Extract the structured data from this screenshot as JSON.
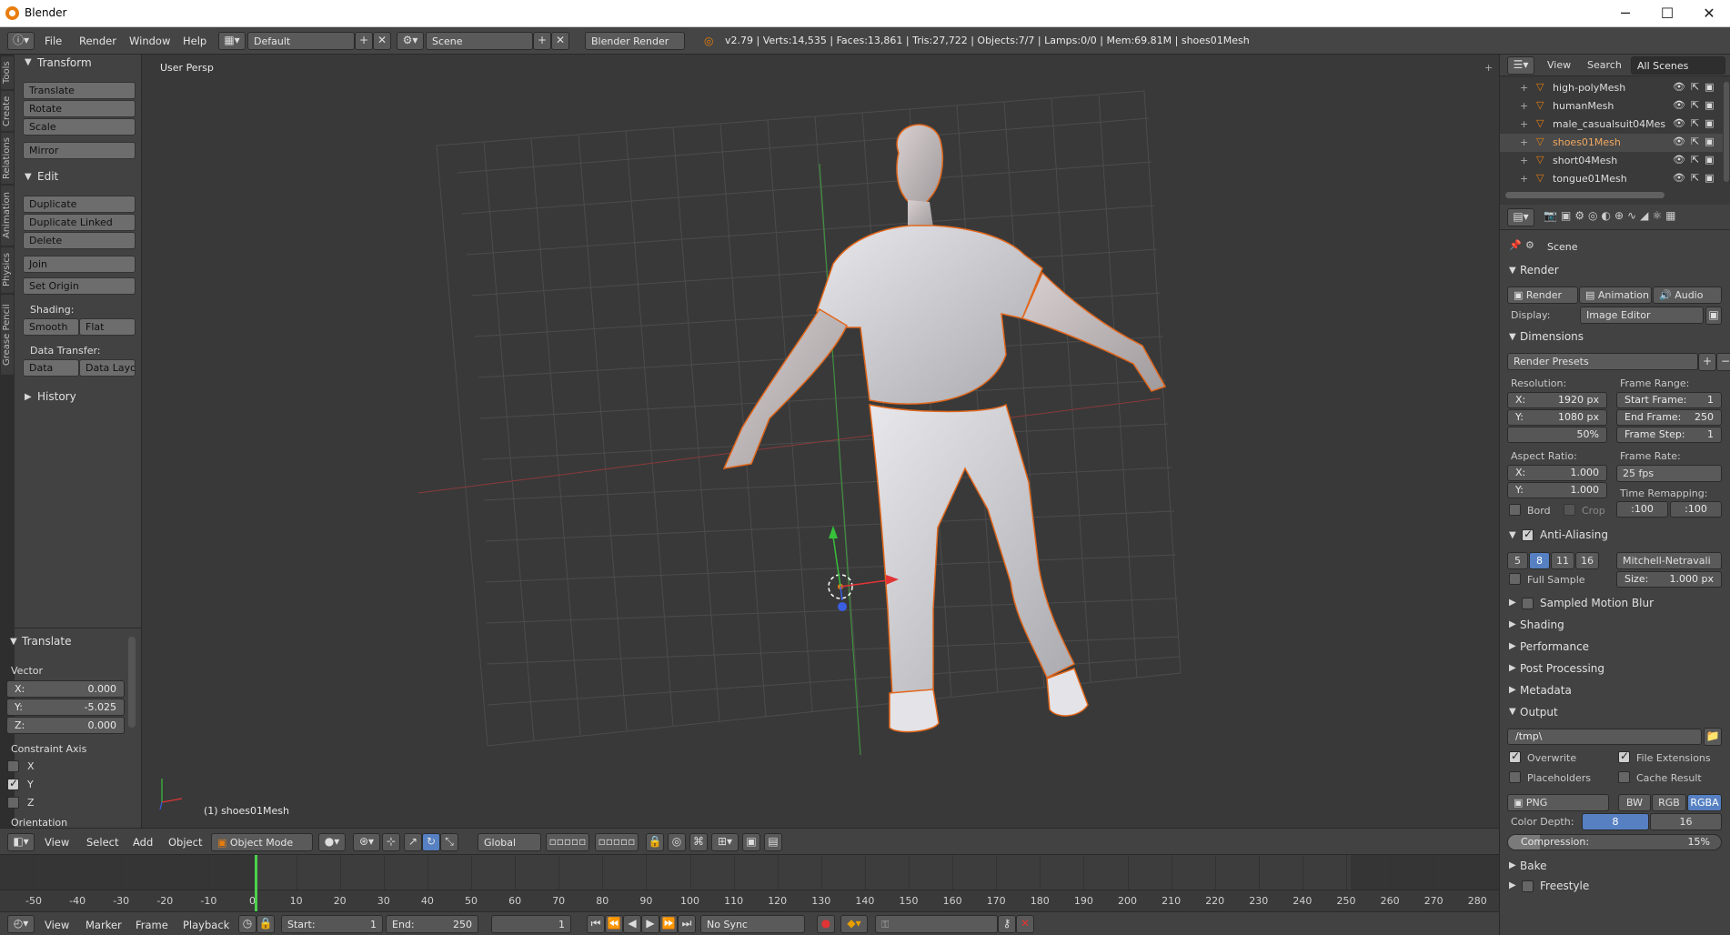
{
  "window": {
    "title": "Blender",
    "minimize": "─",
    "maximize": "☐",
    "close": "✕"
  },
  "info": {
    "menus": [
      "File",
      "Render",
      "Window",
      "Help"
    ],
    "layout": "Default",
    "scene": "Scene",
    "engine": "Blender Render",
    "stats": "v2.79 | Verts:14,535 | Faces:13,861 | Tris:27,722 | Objects:7/7 | Lamps:0/0 | Mem:69.81M | shoes01Mesh"
  },
  "tool_tabs": [
    "Tools",
    "Create",
    "Relations",
    "Animation",
    "Physics",
    "Grease Pencil"
  ],
  "toolshelf": {
    "transform": {
      "title": "Transform",
      "buttons": [
        "Translate",
        "Rotate",
        "Scale",
        "Mirror"
      ]
    },
    "edit": {
      "title": "Edit",
      "buttons": [
        "Duplicate",
        "Duplicate Linked",
        "Delete",
        "Join",
        "Set Origin"
      ]
    },
    "shading": {
      "label": "Shading:",
      "smooth": "Smooth",
      "flat": "Flat"
    },
    "data_transfer": {
      "label": "Data Transfer:",
      "data": "Data",
      "data_layo": "Data Layo"
    },
    "history": "History"
  },
  "operator": {
    "title": "Translate",
    "vector_label": "Vector",
    "x": "X:",
    "xv": "0.000",
    "y": "Y:",
    "yv": "-5.025",
    "z": "Z:",
    "zv": "0.000",
    "constraint_label": "Constraint Axis",
    "cx": "X",
    "cy": "Y",
    "cz": "Z",
    "constraint_checked": "Y",
    "orientation": "Orientation"
  },
  "viewport": {
    "view_name": "User Persp",
    "object_label": "(1) shoes01Mesh"
  },
  "view3d_header": {
    "menus": [
      "View",
      "Select",
      "Add",
      "Object"
    ],
    "mode": "Object Mode",
    "orientation": "Global"
  },
  "timeline": {
    "ticks": [
      "-50",
      "-40",
      "-30",
      "-20",
      "-10",
      "0",
      "10",
      "20",
      "30",
      "40",
      "50",
      "60",
      "70",
      "80",
      "90",
      "100",
      "110",
      "120",
      "130",
      "140",
      "150",
      "160",
      "170",
      "180",
      "190",
      "200",
      "210",
      "220",
      "230",
      "240",
      "250",
      "260",
      "270",
      "280"
    ],
    "current_frame": 1
  },
  "timeline_header": {
    "menus": [
      "View",
      "Marker",
      "Frame",
      "Playback"
    ],
    "start_label": "Start:",
    "start": "1",
    "end_label": "End:",
    "end": "250",
    "frame": "1",
    "sync": "No Sync"
  },
  "outliner": {
    "menus": [
      "View",
      "Search"
    ],
    "scenes_dropdown": "All Scenes",
    "items": [
      "high-polyMesh",
      "humanMesh",
      "male_casualsuit04Mes",
      "shoes01Mesh",
      "short04Mesh",
      "tongue01Mesh"
    ],
    "selected": "shoes01Mesh"
  },
  "properties": {
    "context": "Scene",
    "render_panel": {
      "title": "Render",
      "buttons": [
        "Render",
        "Animation",
        "Audio"
      ],
      "display_label": "Display:",
      "display": "Image Editor"
    },
    "dimensions": {
      "title": "Dimensions",
      "presets": "Render Presets",
      "res_label": "Resolution:",
      "res_x": "1920 px",
      "res_y": "1080 px",
      "res_pct": "50%",
      "x": "X:",
      "y": "Y:",
      "fr_label": "Frame Range:",
      "start": "Start Frame:",
      "start_v": "1",
      "end": "End Frame:",
      "end_v": "250",
      "step": "Frame Step:",
      "step_v": "1",
      "aspect_label": "Aspect Ratio:",
      "asp_x": "1.000",
      "asp_y": "1.000",
      "rate_label": "Frame Rate:",
      "rate": "25 fps",
      "remap_label": "Time Remapping:",
      "remap_old": ":100",
      "remap_new": ":100",
      "bord": "Bord",
      "crop": "Crop"
    },
    "antialias": {
      "title": "Anti-Aliasing",
      "samples": [
        "5",
        "8",
        "11",
        "16"
      ],
      "selected": "8",
      "filter": "Mitchell-Netravali",
      "full_sample": "Full Sample",
      "size": "Size:",
      "size_v": "1.000 px"
    },
    "collapsed": [
      "Sampled Motion Blur",
      "Shading",
      "Performance",
      "Post Processing",
      "Metadata"
    ],
    "output": {
      "title": "Output",
      "path": "/tmp\\",
      "overwrite": "Overwrite",
      "file_ext": "File Extensions",
      "placeholders": "Placeholders",
      "cache": "Cache Result",
      "format": "PNG",
      "bw": "BW",
      "rgb": "RGB",
      "rgba": "RGBA",
      "color_depth": "Color Depth:",
      "d8": "8",
      "d16": "16",
      "compression": "Compression:",
      "compression_v": "15%",
      "compression_pct": 15
    },
    "after": [
      "Bake",
      "Freestyle"
    ]
  }
}
